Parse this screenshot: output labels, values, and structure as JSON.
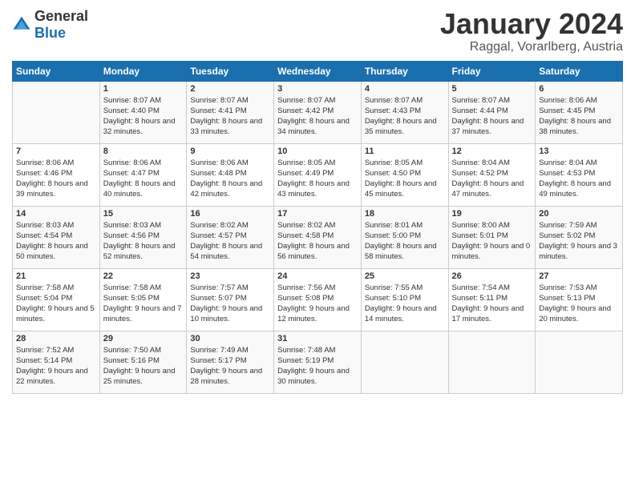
{
  "logo": {
    "general": "General",
    "blue": "Blue"
  },
  "title": "January 2024",
  "subtitle": "Raggal, Vorarlberg, Austria",
  "weekdays": [
    "Sunday",
    "Monday",
    "Tuesday",
    "Wednesday",
    "Thursday",
    "Friday",
    "Saturday"
  ],
  "weeks": [
    [
      {
        "day": "",
        "sunrise": "",
        "sunset": "",
        "daylight": ""
      },
      {
        "day": "1",
        "sunrise": "Sunrise: 8:07 AM",
        "sunset": "Sunset: 4:40 PM",
        "daylight": "Daylight: 8 hours and 32 minutes."
      },
      {
        "day": "2",
        "sunrise": "Sunrise: 8:07 AM",
        "sunset": "Sunset: 4:41 PM",
        "daylight": "Daylight: 8 hours and 33 minutes."
      },
      {
        "day": "3",
        "sunrise": "Sunrise: 8:07 AM",
        "sunset": "Sunset: 4:42 PM",
        "daylight": "Daylight: 8 hours and 34 minutes."
      },
      {
        "day": "4",
        "sunrise": "Sunrise: 8:07 AM",
        "sunset": "Sunset: 4:43 PM",
        "daylight": "Daylight: 8 hours and 35 minutes."
      },
      {
        "day": "5",
        "sunrise": "Sunrise: 8:07 AM",
        "sunset": "Sunset: 4:44 PM",
        "daylight": "Daylight: 8 hours and 37 minutes."
      },
      {
        "day": "6",
        "sunrise": "Sunrise: 8:06 AM",
        "sunset": "Sunset: 4:45 PM",
        "daylight": "Daylight: 8 hours and 38 minutes."
      }
    ],
    [
      {
        "day": "7",
        "sunrise": "Sunrise: 8:06 AM",
        "sunset": "Sunset: 4:46 PM",
        "daylight": "Daylight: 8 hours and 39 minutes."
      },
      {
        "day": "8",
        "sunrise": "Sunrise: 8:06 AM",
        "sunset": "Sunset: 4:47 PM",
        "daylight": "Daylight: 8 hours and 40 minutes."
      },
      {
        "day": "9",
        "sunrise": "Sunrise: 8:06 AM",
        "sunset": "Sunset: 4:48 PM",
        "daylight": "Daylight: 8 hours and 42 minutes."
      },
      {
        "day": "10",
        "sunrise": "Sunrise: 8:05 AM",
        "sunset": "Sunset: 4:49 PM",
        "daylight": "Daylight: 8 hours and 43 minutes."
      },
      {
        "day": "11",
        "sunrise": "Sunrise: 8:05 AM",
        "sunset": "Sunset: 4:50 PM",
        "daylight": "Daylight: 8 hours and 45 minutes."
      },
      {
        "day": "12",
        "sunrise": "Sunrise: 8:04 AM",
        "sunset": "Sunset: 4:52 PM",
        "daylight": "Daylight: 8 hours and 47 minutes."
      },
      {
        "day": "13",
        "sunrise": "Sunrise: 8:04 AM",
        "sunset": "Sunset: 4:53 PM",
        "daylight": "Daylight: 8 hours and 49 minutes."
      }
    ],
    [
      {
        "day": "14",
        "sunrise": "Sunrise: 8:03 AM",
        "sunset": "Sunset: 4:54 PM",
        "daylight": "Daylight: 8 hours and 50 minutes."
      },
      {
        "day": "15",
        "sunrise": "Sunrise: 8:03 AM",
        "sunset": "Sunset: 4:56 PM",
        "daylight": "Daylight: 8 hours and 52 minutes."
      },
      {
        "day": "16",
        "sunrise": "Sunrise: 8:02 AM",
        "sunset": "Sunset: 4:57 PM",
        "daylight": "Daylight: 8 hours and 54 minutes."
      },
      {
        "day": "17",
        "sunrise": "Sunrise: 8:02 AM",
        "sunset": "Sunset: 4:58 PM",
        "daylight": "Daylight: 8 hours and 56 minutes."
      },
      {
        "day": "18",
        "sunrise": "Sunrise: 8:01 AM",
        "sunset": "Sunset: 5:00 PM",
        "daylight": "Daylight: 8 hours and 58 minutes."
      },
      {
        "day": "19",
        "sunrise": "Sunrise: 8:00 AM",
        "sunset": "Sunset: 5:01 PM",
        "daylight": "Daylight: 9 hours and 0 minutes."
      },
      {
        "day": "20",
        "sunrise": "Sunrise: 7:59 AM",
        "sunset": "Sunset: 5:02 PM",
        "daylight": "Daylight: 9 hours and 3 minutes."
      }
    ],
    [
      {
        "day": "21",
        "sunrise": "Sunrise: 7:58 AM",
        "sunset": "Sunset: 5:04 PM",
        "daylight": "Daylight: 9 hours and 5 minutes."
      },
      {
        "day": "22",
        "sunrise": "Sunrise: 7:58 AM",
        "sunset": "Sunset: 5:05 PM",
        "daylight": "Daylight: 9 hours and 7 minutes."
      },
      {
        "day": "23",
        "sunrise": "Sunrise: 7:57 AM",
        "sunset": "Sunset: 5:07 PM",
        "daylight": "Daylight: 9 hours and 10 minutes."
      },
      {
        "day": "24",
        "sunrise": "Sunrise: 7:56 AM",
        "sunset": "Sunset: 5:08 PM",
        "daylight": "Daylight: 9 hours and 12 minutes."
      },
      {
        "day": "25",
        "sunrise": "Sunrise: 7:55 AM",
        "sunset": "Sunset: 5:10 PM",
        "daylight": "Daylight: 9 hours and 14 minutes."
      },
      {
        "day": "26",
        "sunrise": "Sunrise: 7:54 AM",
        "sunset": "Sunset: 5:11 PM",
        "daylight": "Daylight: 9 hours and 17 minutes."
      },
      {
        "day": "27",
        "sunrise": "Sunrise: 7:53 AM",
        "sunset": "Sunset: 5:13 PM",
        "daylight": "Daylight: 9 hours and 20 minutes."
      }
    ],
    [
      {
        "day": "28",
        "sunrise": "Sunrise: 7:52 AM",
        "sunset": "Sunset: 5:14 PM",
        "daylight": "Daylight: 9 hours and 22 minutes."
      },
      {
        "day": "29",
        "sunrise": "Sunrise: 7:50 AM",
        "sunset": "Sunset: 5:16 PM",
        "daylight": "Daylight: 9 hours and 25 minutes."
      },
      {
        "day": "30",
        "sunrise": "Sunrise: 7:49 AM",
        "sunset": "Sunset: 5:17 PM",
        "daylight": "Daylight: 9 hours and 28 minutes."
      },
      {
        "day": "31",
        "sunrise": "Sunrise: 7:48 AM",
        "sunset": "Sunset: 5:19 PM",
        "daylight": "Daylight: 9 hours and 30 minutes."
      },
      {
        "day": "",
        "sunrise": "",
        "sunset": "",
        "daylight": ""
      },
      {
        "day": "",
        "sunrise": "",
        "sunset": "",
        "daylight": ""
      },
      {
        "day": "",
        "sunrise": "",
        "sunset": "",
        "daylight": ""
      }
    ]
  ]
}
